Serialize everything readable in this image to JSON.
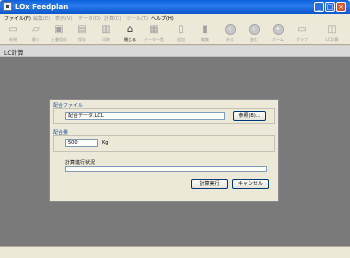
{
  "window": {
    "title": "LOx Feedplan"
  },
  "menu": [
    {
      "label": "ファイル(F)",
      "enabled": true
    },
    {
      "label": "編集(E)",
      "enabled": false
    },
    {
      "label": "表示(V)",
      "enabled": false
    },
    {
      "label": "データ(D)",
      "enabled": false
    },
    {
      "label": "計算(C)",
      "enabled": false
    },
    {
      "label": "ツール(T)",
      "enabled": false
    },
    {
      "label": "ヘルプ(H)",
      "enabled": true
    }
  ],
  "toolbar": [
    {
      "label": "新規",
      "icon": "new-file-icon",
      "enabled": false
    },
    {
      "label": "開く",
      "icon": "open-icon",
      "enabled": false
    },
    {
      "label": "上書保存",
      "icon": "save-icon",
      "enabled": false
    },
    {
      "label": "保存",
      "icon": "save-as-icon",
      "enabled": false
    },
    {
      "label": "印刷",
      "icon": "print-icon",
      "enabled": false
    },
    {
      "label": "閉じる",
      "icon": "close-doc-icon",
      "enabled": true
    },
    {
      "label": "データ一覧",
      "icon": "data-list-icon",
      "enabled": true
    },
    {
      "label": "追加",
      "icon": "add-icon",
      "enabled": false
    },
    {
      "label": "編集",
      "icon": "edit-icon",
      "enabled": false
    },
    {
      "label": "戻る",
      "icon": "back-icon",
      "enabled": false
    },
    {
      "label": "進む",
      "icon": "forward-icon",
      "enabled": false
    },
    {
      "label": "ホーム",
      "icon": "home-icon",
      "enabled": false
    },
    {
      "label": "グラフ",
      "icon": "graph-icon",
      "enabled": false
    },
    {
      "label": "LC計算",
      "icon": "lc-calc-icon",
      "enabled": false
    }
  ],
  "page": {
    "title": "LC計算"
  },
  "form": {
    "file_group_label": "配合ファイル",
    "file_value": "配合データ.LCL",
    "browse_label": "参照(B)...",
    "amount_group_label": "配合量",
    "amount_value": "500",
    "amount_unit": "Kg",
    "progress_label": "計算進行状況",
    "progress": 0,
    "run_label": "計算実行",
    "cancel_label": "キャンセル"
  },
  "colors": {
    "titlebar": "#0a5fd8",
    "workspace": "#7a7a7a",
    "panel": "#ece9d8",
    "group_label": "#1f4ea0"
  }
}
